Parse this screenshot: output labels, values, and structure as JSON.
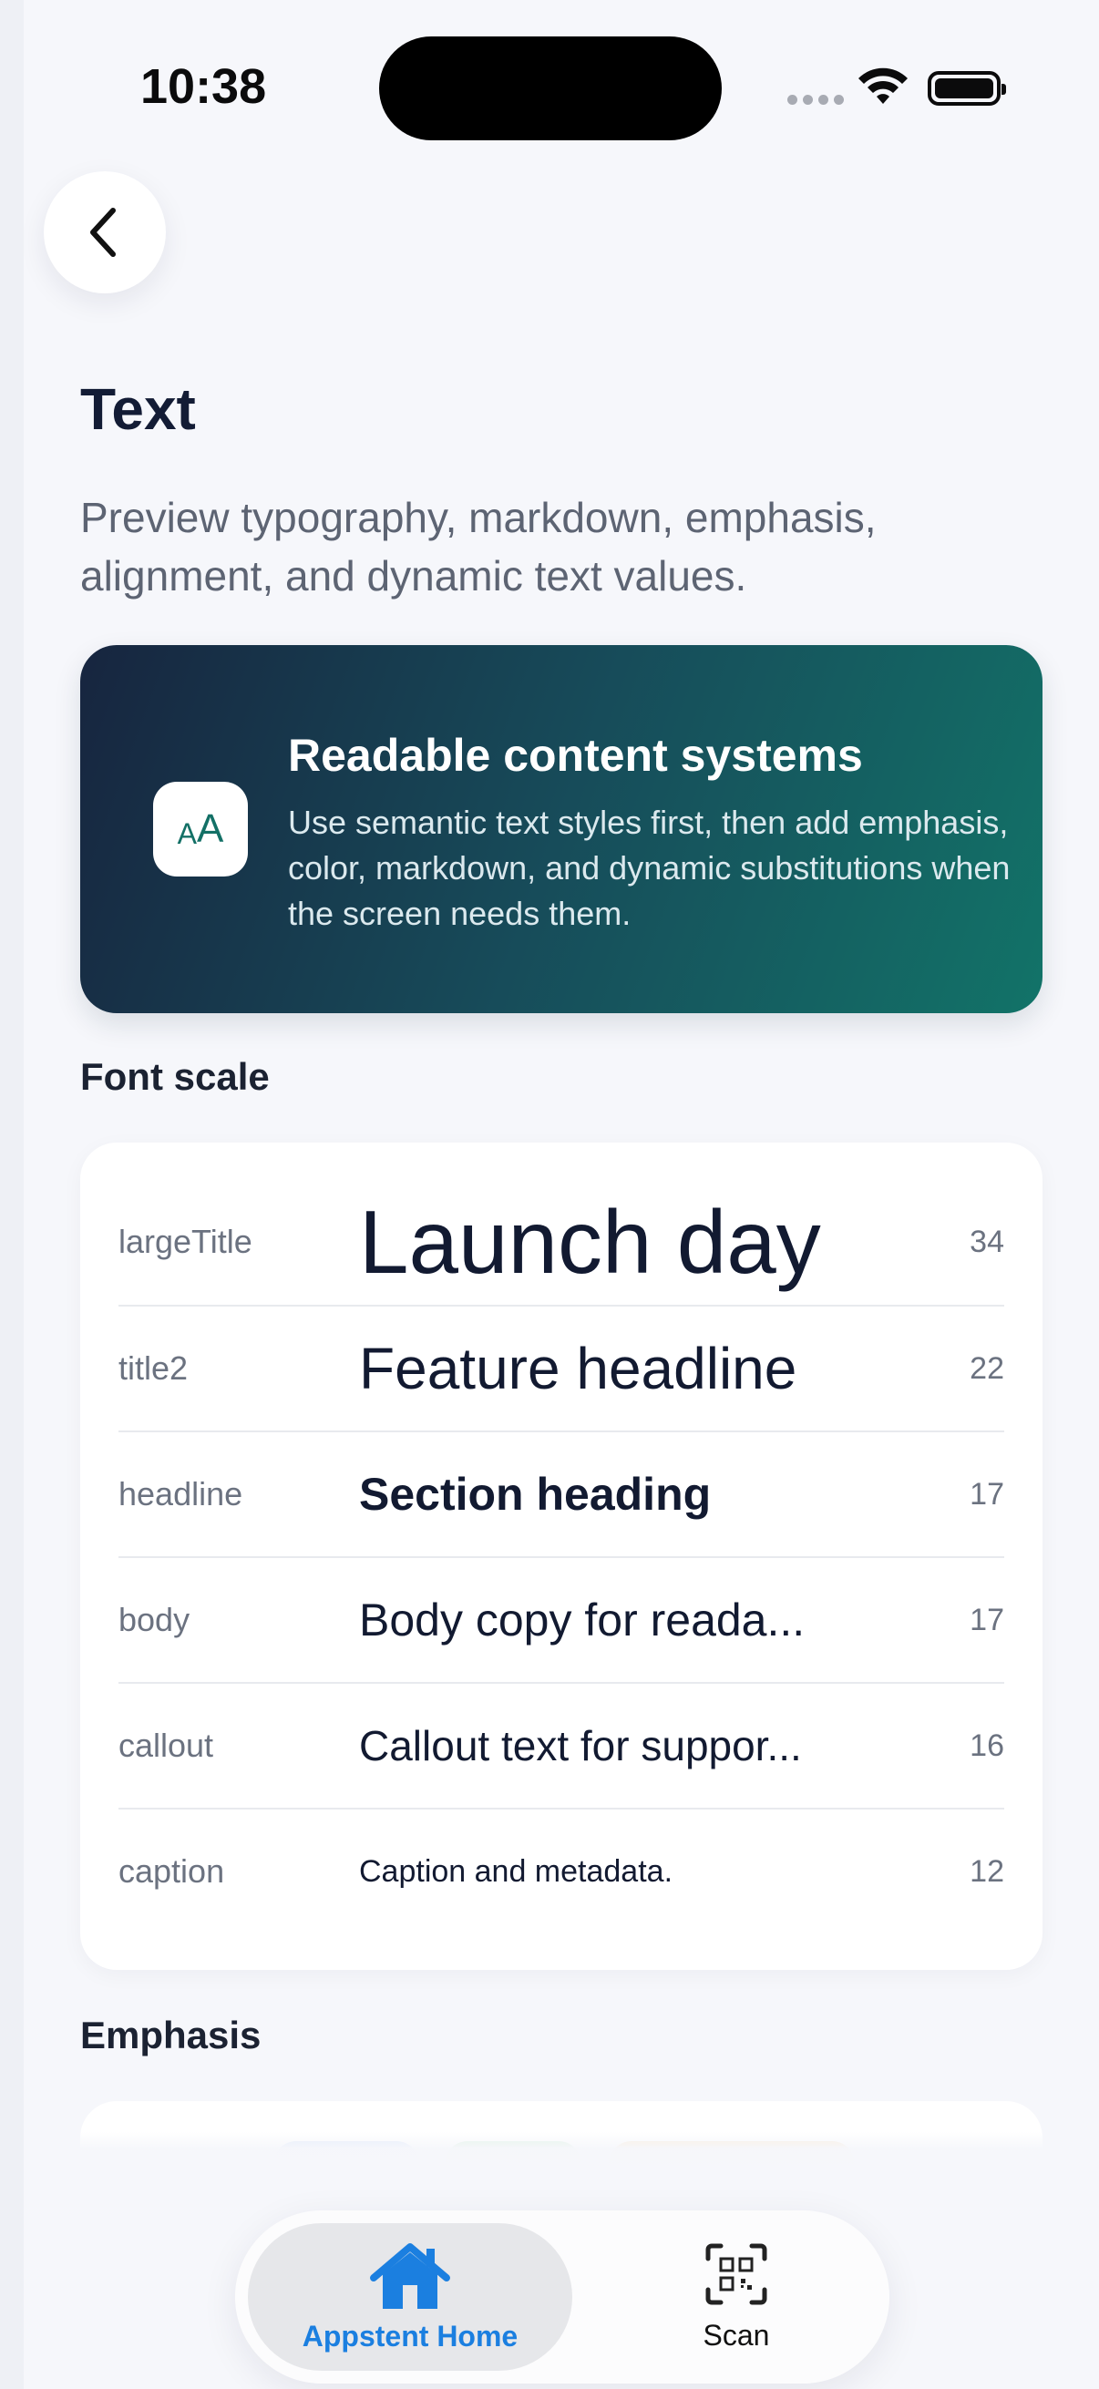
{
  "status_bar": {
    "time": "10:38"
  },
  "header": {
    "title": "Text",
    "subtitle": "Preview typography, markdown, emphasis, alignment, and dynamic text values."
  },
  "hero": {
    "icon_small": "A",
    "icon_large": "A",
    "title": "Readable content systems",
    "body": "Use semantic text styles first, then add emphasis, color, markdown, and dynamic substitutions when the screen needs them."
  },
  "font_scale": {
    "label": "Font scale",
    "rows": [
      {
        "style": "largeTitle",
        "sample": "Launch day",
        "size": "34"
      },
      {
        "style": "title2",
        "sample": "Feature headline",
        "size": "22"
      },
      {
        "style": "headline",
        "sample": "Section heading",
        "size": "17"
      },
      {
        "style": "body",
        "sample": "Body copy for reada...",
        "size": "17"
      },
      {
        "style": "callout",
        "sample": "Callout text for suppor...",
        "size": "16"
      },
      {
        "style": "caption",
        "sample": "Caption and metadata.",
        "size": "12"
      }
    ]
  },
  "emphasis": {
    "label": "Emphasis"
  },
  "tabbar": {
    "home_label": "Appstent Home",
    "scan_label": "Scan"
  },
  "colors": {
    "accent": "#1b7fe0",
    "hero_start": "#17253f",
    "hero_end": "#127368"
  }
}
